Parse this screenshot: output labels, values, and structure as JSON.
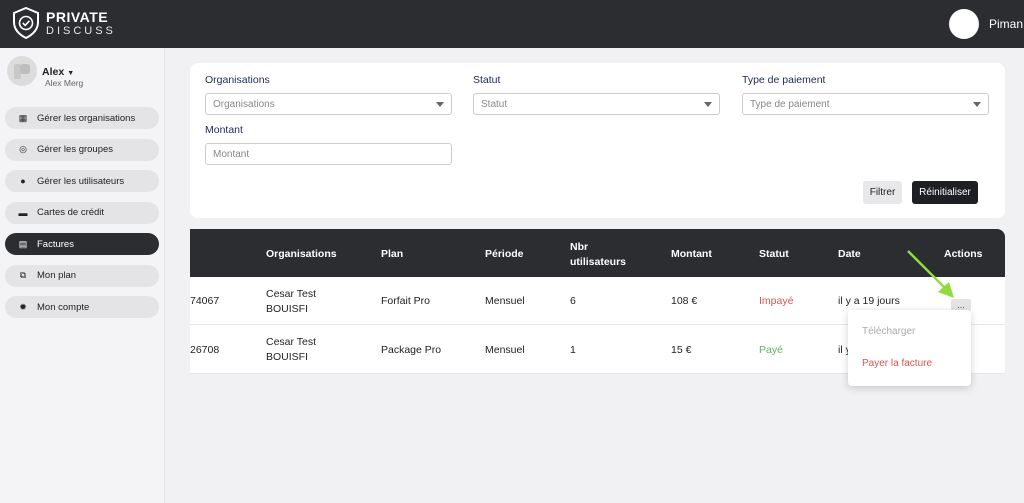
{
  "app": {
    "logo_line1": "PRIVATE",
    "logo_line2": "DISCUSS",
    "top_user": "Piman"
  },
  "user": {
    "name": "Alex",
    "subtitle": "Alex Merg"
  },
  "sidebar": {
    "items": [
      {
        "label": "Gérer les organisations",
        "icon": "building-icon",
        "glyph": "▦",
        "active": false
      },
      {
        "label": "Gérer les groupes",
        "icon": "group-icon",
        "glyph": "◎",
        "active": false
      },
      {
        "label": "Gérer les utilisateurs",
        "icon": "user-icon",
        "glyph": "●",
        "active": false
      },
      {
        "label": "Cartes de crédit",
        "icon": "credit-card-icon",
        "glyph": "▬",
        "active": false
      },
      {
        "label": "Factures",
        "icon": "invoice-icon",
        "glyph": "▤",
        "active": true
      },
      {
        "label": "Mon plan",
        "icon": "plan-icon",
        "glyph": "⧉",
        "active": false
      },
      {
        "label": "Mon compte",
        "icon": "gear-icon",
        "glyph": "✹",
        "active": false
      }
    ]
  },
  "filters": {
    "organisations": {
      "label": "Organisations",
      "placeholder": "Organisations"
    },
    "statut": {
      "label": "Statut",
      "placeholder": "Statut"
    },
    "type_paiement": {
      "label": "Type de paiement",
      "placeholder": "Type de paiement"
    },
    "montant": {
      "label": "Montant",
      "placeholder": "Montant"
    },
    "filter_button": "Filtrer",
    "reset_button": "Réinitialiser"
  },
  "table": {
    "headers": {
      "organisations": "Organisations",
      "plan": "Plan",
      "periode": "Période",
      "nbr_line1": "Nbr",
      "nbr_line2": "utilisateurs",
      "montant": "Montant",
      "statut": "Statut",
      "date": "Date",
      "actions": "Actions"
    },
    "rows": [
      {
        "id": "74067",
        "org_line1": "Cesar Test",
        "org_line2": "BOUISFI",
        "plan": "Forfait Pro",
        "periode": "Mensuel",
        "users": "6",
        "montant": "108 €",
        "statut": "Impayé",
        "date": "il y a 19 jours"
      },
      {
        "id": "26708",
        "org_line1": "Cesar Test",
        "org_line2": "BOUISFI",
        "plan": "Package Pro",
        "periode": "Mensuel",
        "users": "1",
        "montant": "15 €",
        "statut": "Payé",
        "date": "il y"
      }
    ],
    "actions_button": "..."
  },
  "dropdown": {
    "download": "Télécharger",
    "pay": "Payer la facture"
  },
  "colors": {
    "topbar": "#2b2d31",
    "unpaid": "#d9534f",
    "paid": "#5cb85c",
    "arrow": "#8fdc3c"
  }
}
